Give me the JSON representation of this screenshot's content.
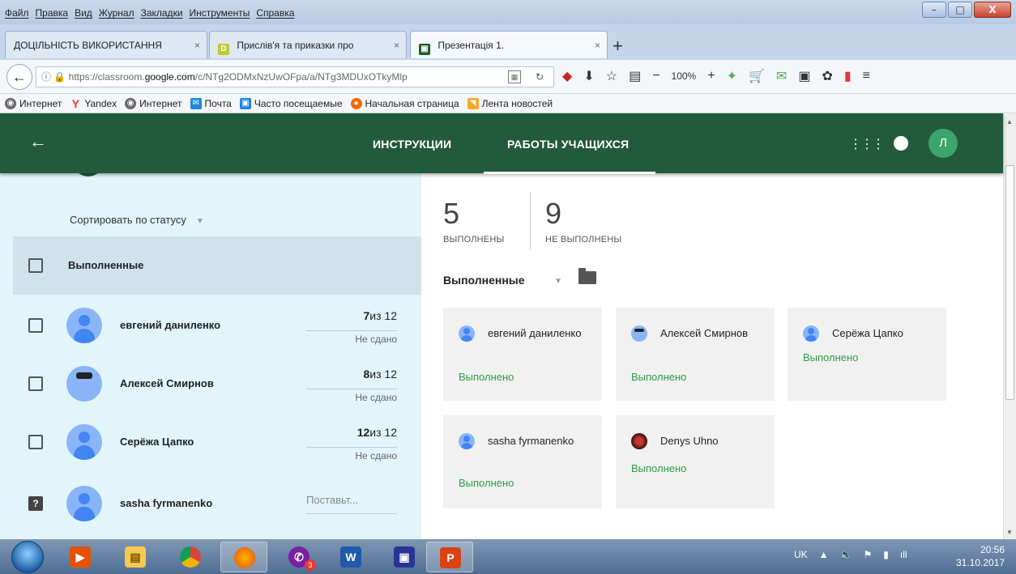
{
  "browser": {
    "menu": [
      "Файл",
      "Правка",
      "Вид",
      "Журнал",
      "Закладки",
      "Инструменты",
      "Справка"
    ],
    "window_controls": [
      "–",
      "□",
      "X"
    ],
    "tabs": [
      {
        "label": "ДОЦІЛЬНІСТЬ ВИКОРИСТАННЯ",
        "favicon": ""
      },
      {
        "label": "Прислів'я та приказки про",
        "favicon": "D"
      },
      {
        "label": "Презентація 1.",
        "favicon": "▣"
      }
    ],
    "url": {
      "prefix": "https://classroom.",
      "domain": "google.com",
      "path": "/c/NTg2ODMxNzUwOFpa/a/NTg3MDUxOTkyMlp"
    },
    "zoom": "100%",
    "bookmarks": [
      {
        "label": "Интернет",
        "icon": "globe-icon",
        "color": "#666"
      },
      {
        "label": "Yandex",
        "icon": "yandex-icon",
        "color": "#e53935"
      },
      {
        "label": "Интернет",
        "icon": "globe-icon",
        "color": "#666"
      },
      {
        "label": "Почта",
        "icon": "mail-icon",
        "color": "#1e88e5"
      },
      {
        "label": "Часто посещаемые",
        "icon": "folder-icon",
        "color": "#1e88e5"
      },
      {
        "label": "Начальная страница",
        "icon": "firefox-icon",
        "color": "#ef6c00"
      },
      {
        "label": "Лента новостей",
        "icon": "rss-icon",
        "color": "#f9a825"
      }
    ]
  },
  "classroom": {
    "tabs": [
      "ИНСТРУКЦИИ",
      "РАБОТЫ УЧАЩИХСЯ"
    ],
    "avatar_letter": "Л",
    "brand_color": "#225a3d",
    "sort_label": "Сортировать по статусу",
    "group_label": "Выполненные",
    "students": [
      {
        "name": "евгений даниленко",
        "grade": "7",
        "of": "из 12",
        "status": "Не сдано",
        "avatar": "default"
      },
      {
        "name": "Алексей Смирнов",
        "grade": "8",
        "of": "из 12",
        "status": "Не сдано",
        "avatar": "photo"
      },
      {
        "name": "Серёжа Цапко",
        "grade": "12",
        "of": "из 12",
        "status": "Не сдано",
        "avatar": "default"
      },
      {
        "name": "sasha fyrmanenko",
        "placeholder": "Поставьт...",
        "avatar": "default"
      }
    ],
    "stats": [
      {
        "value": "5",
        "caption": "ВЫПОЛНЕНЫ"
      },
      {
        "value": "9",
        "caption": "НЕ ВЫПОЛНЕНЫ"
      }
    ],
    "filter_label": "Выполненные",
    "cards": [
      {
        "name": "евгений даниленко",
        "status": "Выполнено",
        "avatar": "default"
      },
      {
        "name": "Алексей Смирнов",
        "status": "Выполнено",
        "avatar": "photo"
      },
      {
        "name": "Серёжа Цапко",
        "status": "Выполнено",
        "avatar": "default"
      },
      {
        "name": "sasha fyrmanenko",
        "status": "Выполнено",
        "avatar": "default"
      },
      {
        "name": "Denys Uhno",
        "status": "Выполнено",
        "avatar": "dark"
      }
    ]
  },
  "taskbar": {
    "apps": [
      "media-player-icon",
      "file-explorer-icon",
      "chrome-icon",
      "firefox-icon",
      "viber-icon",
      "word-icon",
      "save-icon",
      "powerpoint-icon"
    ],
    "viber_badge": "3",
    "lang": "UK",
    "time": "20:56",
    "date": "31.10.2017"
  }
}
